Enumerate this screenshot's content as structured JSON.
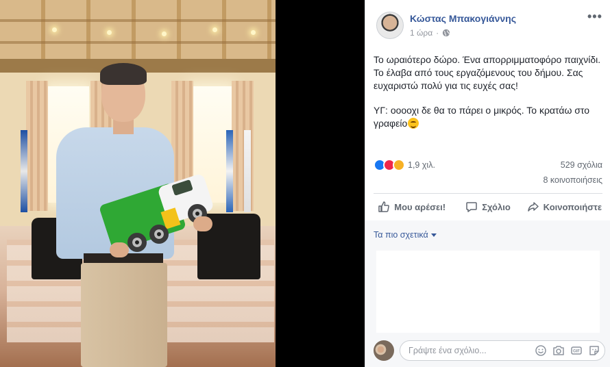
{
  "post": {
    "author": "Κώστας Μπακογιάννης",
    "time": "1 ώρα",
    "text": [
      "Το ωραιότερο δώρο. Ένα απορριμματοφόρο παιχνίδι. Το έλαβα από τους εργαζόμενους του δήμου. Σας ευχαριστώ πολύ για τις ευχές σας!",
      "ΥΓ: οοοοχι δε θα το πάρει ο μικρός. Το κρατάω στο γραφείο"
    ],
    "emoji": "smiling-face-emoji"
  },
  "stats": {
    "reactions": "1,9 χιλ.",
    "comments": "529 σχόλια",
    "shares": "8 κοινοποιήσεις"
  },
  "actions": {
    "like": "Μου αρέσει!",
    "comment": "Σχόλιο",
    "share": "Κοινοποιήστε"
  },
  "comments": {
    "sort_label": "Τα πιο σχετικά",
    "input_placeholder": "Γράψτε ένα σχόλιο..."
  },
  "colors": {
    "link": "#365899",
    "like_blue": "#1877f2",
    "love_red": "#f0284a",
    "haha_yellow": "#f7b125"
  }
}
